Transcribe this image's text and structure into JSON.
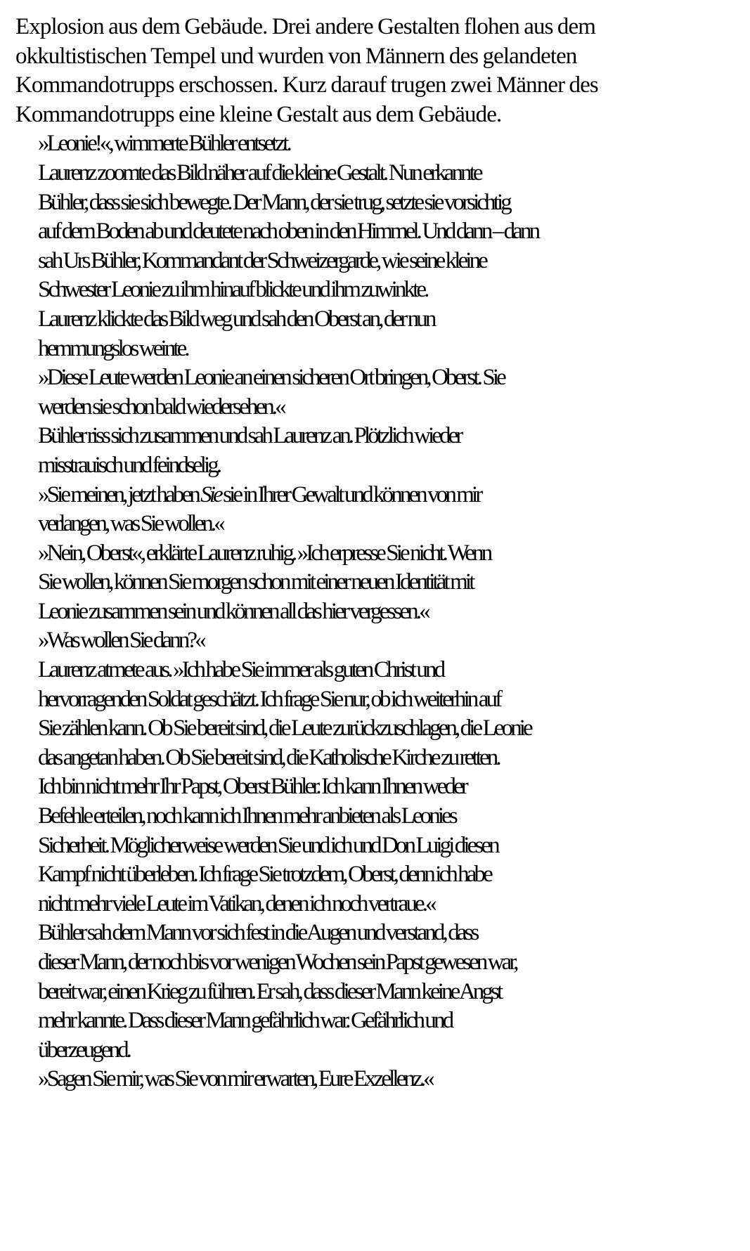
{
  "paragraphs": [
    {
      "indent": false,
      "lines": [
        "Explosion aus dem Gebäude. Drei andere Gestalten flohen aus dem",
        "okkultistischen Tempel und wurden von Männern des gelandeten",
        "Kommandotrupps erschossen. Kurz darauf trugen zwei Männer des",
        "Kommandotrupps eine kleine Gestalt aus dem Gebäude."
      ]
    },
    {
      "indent": true,
      "lines": [
        "»Leonie!«, wimmerte Bühler entsetzt."
      ]
    },
    {
      "indent": true,
      "lines": [
        "Laurenz zoomte das Bild näher auf die kleine Gestalt. Nun erkannte",
        "Bühler, dass sie sich bewegte. Der Mann, der sie trug, setzte sie vorsichtig",
        "auf dem Boden ab und deutete nach oben in den Himmel. Und dann – dann",
        "sah Urs Bühler, Kommandant der Schweizergarde, wie seine kleine",
        "Schwester Leonie zu ihm hinauf blickte und ihm zuwinkte."
      ]
    },
    {
      "indent": true,
      "lines": [
        "Laurenz klickte das Bild weg und sah den Oberst an, der nun",
        "hemmungslos weinte."
      ]
    },
    {
      "indent": true,
      "lines": [
        "»Diese Leute werden Leonie an einen sicheren Ort bringen, Oberst. Sie",
        "werden sie schon bald wiedersehen.«"
      ]
    },
    {
      "indent": true,
      "lines": [
        "Bühler riss sich zusammen und sah Laurenz an. Plötzlich wieder",
        "misstrauisch und feindselig."
      ]
    },
    {
      "indent": true,
      "lines": [
        {
          "before": "»Sie meinen, jetzt haben ",
          "em": "Sie",
          "after": " sie in Ihrer Gewalt und können von mir"
        },
        "verlangen, was Sie wollen.«"
      ]
    },
    {
      "indent": true,
      "lines": [
        "»Nein, Oberst«, erklärte Laurenz ruhig. »Ich erpresse Sie nicht. Wenn",
        "Sie wollen, können Sie morgen schon mit einer neuen Identität mit",
        "Leonie zusammen sein und können all das hier vergessen.«"
      ]
    },
    {
      "indent": true,
      "lines": [
        "»Was wollen Sie dann?«"
      ]
    },
    {
      "indent": true,
      "lines": [
        "Laurenz atmete aus. »Ich habe Sie immer als guten Christ und",
        "hervorragenden Soldat geschätzt. Ich frage Sie nur, ob ich weiterhin auf",
        "Sie zählen kann. Ob Sie bereit sind, die Leute zurückzuschlagen, die Leonie",
        "das angetan haben. Ob Sie bereit sind, die Katholische Kirche zu retten.",
        "Ich bin nicht mehr Ihr Papst, Oberst Bühler. Ich kann Ihnen weder",
        "Befehle erteilen, noch kann ich Ihnen mehr anbieten als Leonies",
        "Sicherheit. Möglicherweise werden Sie und ich und Don Luigi diesen",
        "Kampf nicht überleben. Ich frage Sie trotzdem, Oberst, denn ich habe",
        "nicht mehr viele Leute im Vatikan, denen ich noch vertraue.«"
      ]
    },
    {
      "indent": true,
      "lines": [
        "Bühler sah dem Mann vor sich fest in die Augen und verstand, dass",
        "dieser Mann, der noch bis vor wenigen Wochen sein Papst gewesen war,",
        "bereit war, einen Krieg zu führen. Er sah, dass dieser Mann keine Angst",
        "mehr kannte. Dass dieser Mann gefährlich war. Gefährlich und",
        "überzeugend."
      ]
    },
    {
      "indent": true,
      "lines": [
        "»Sagen Sie mir, was Sie von mir erwarten, Eure Exzellenz.«"
      ]
    }
  ]
}
